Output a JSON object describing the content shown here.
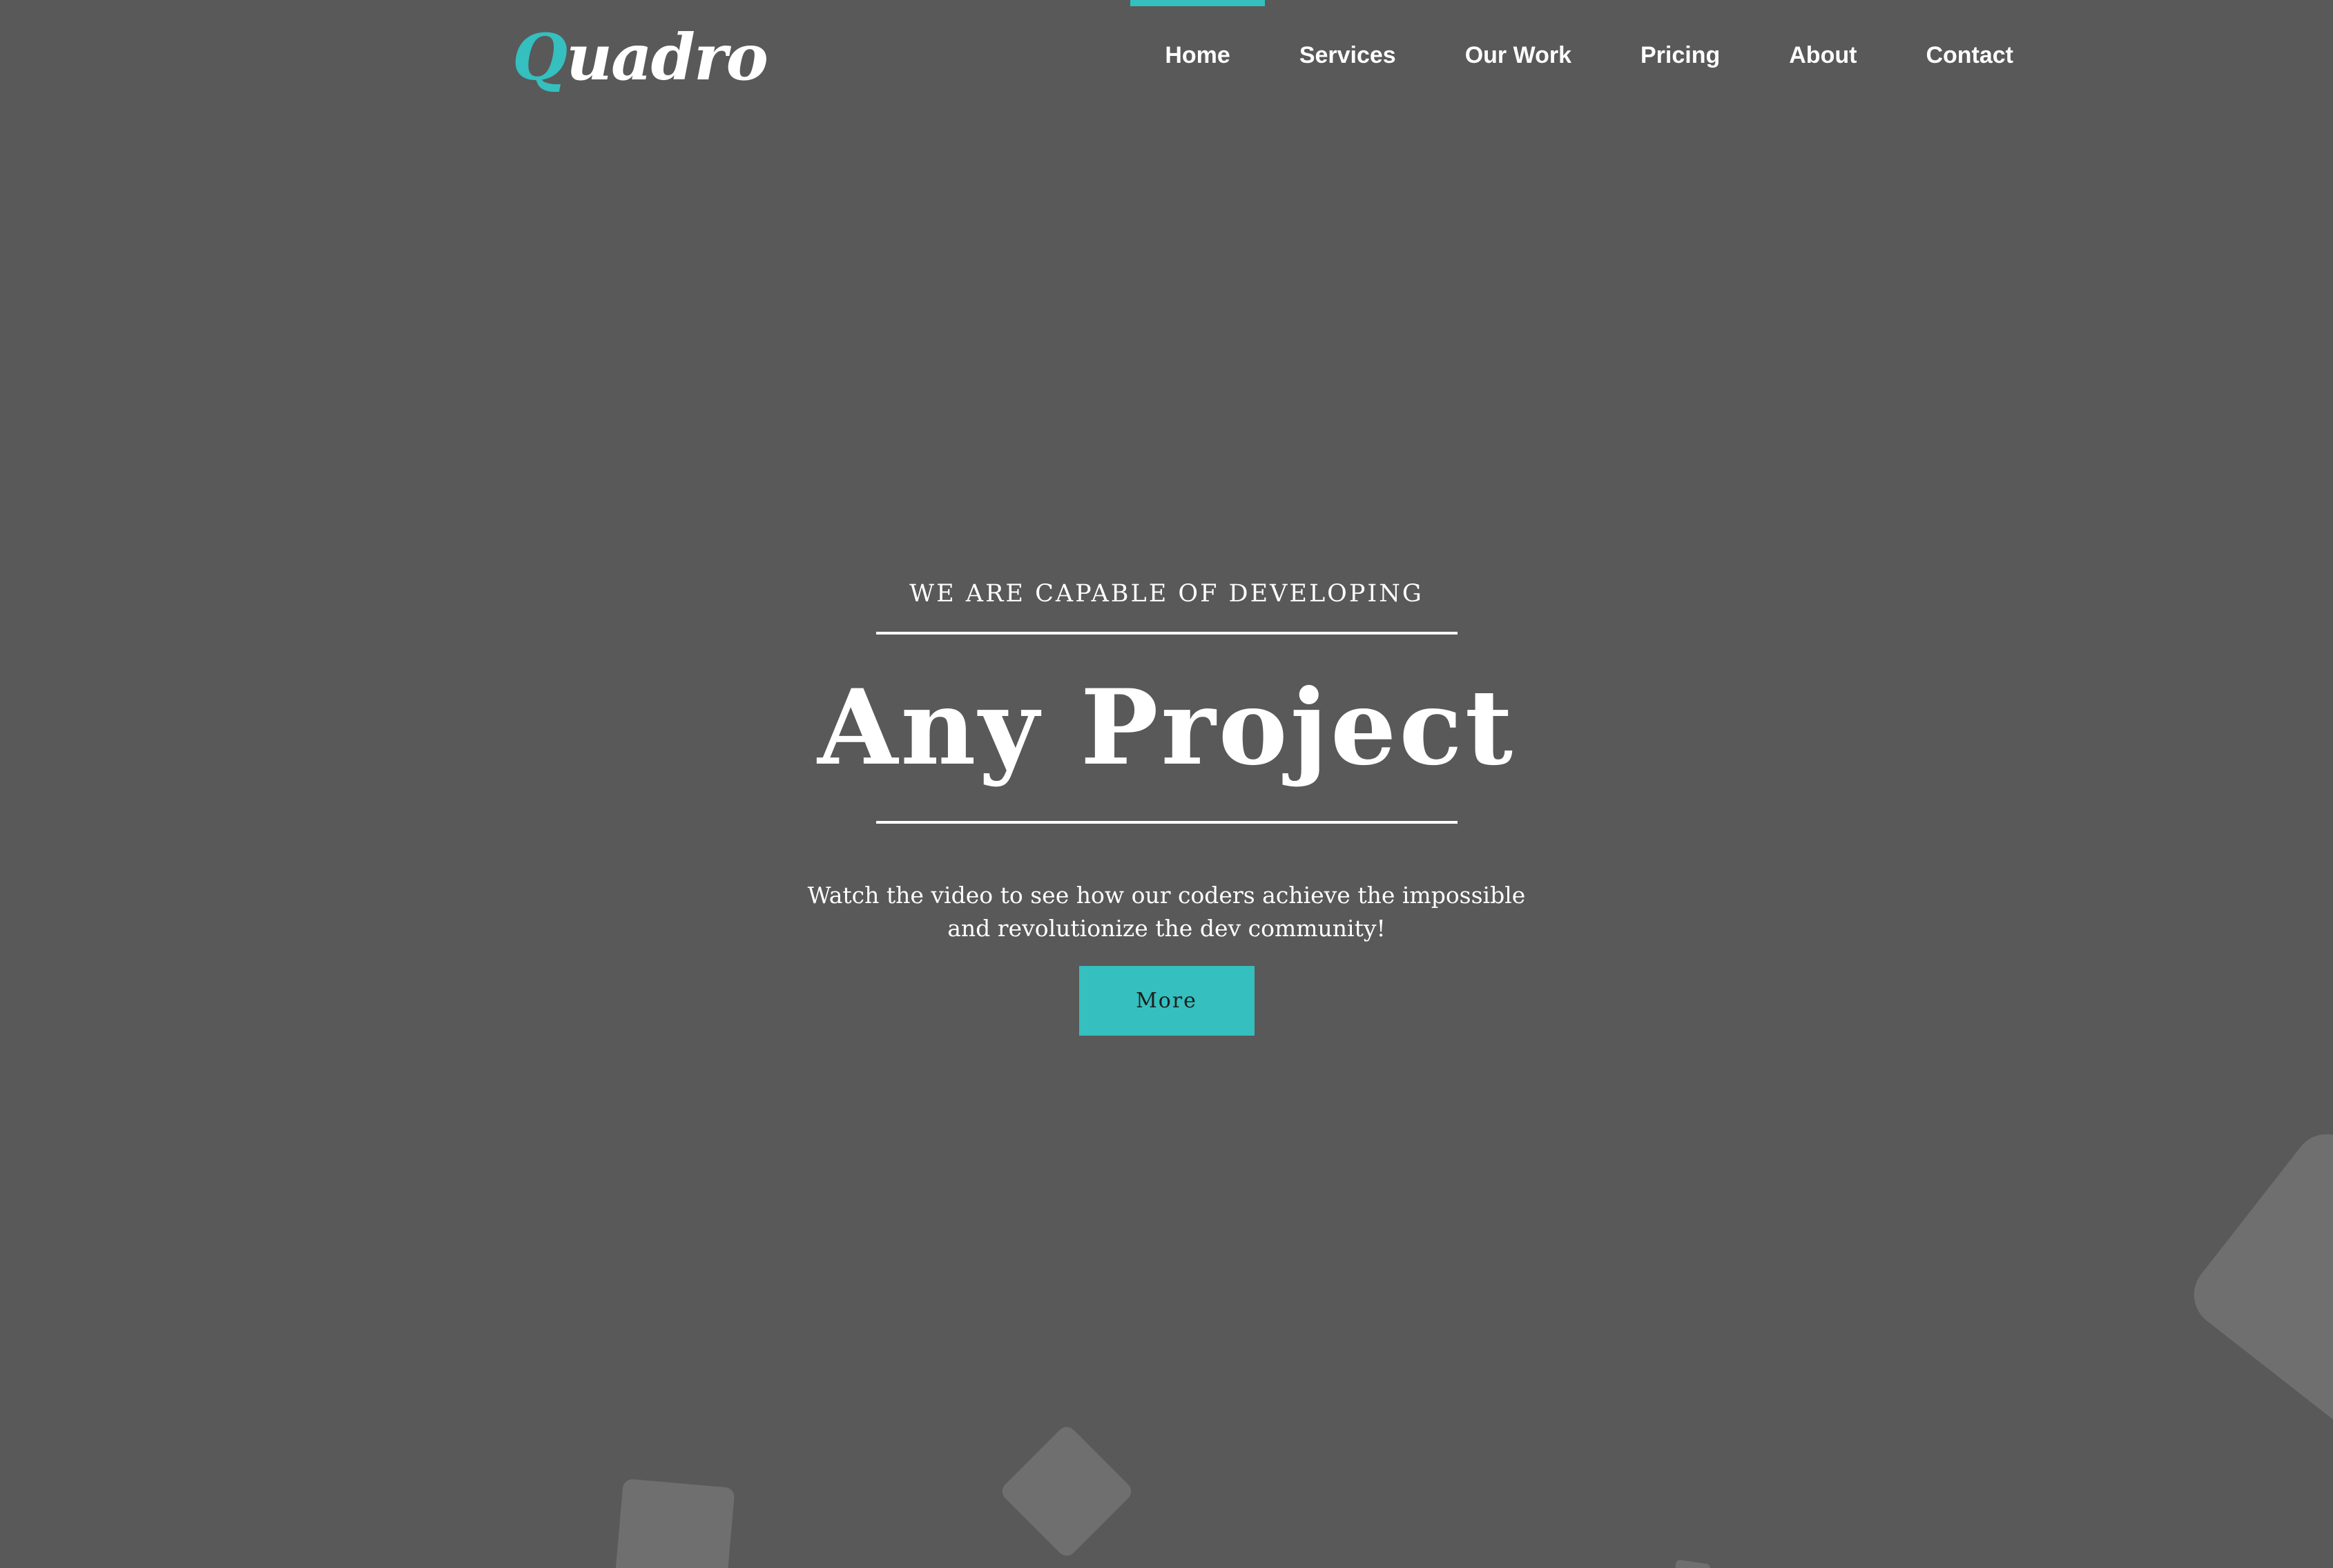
{
  "brand": {
    "logo_initial": "Q",
    "logo_rest": "uadro",
    "accent_color": "#35bfbf"
  },
  "nav": {
    "items": [
      {
        "label": "Home",
        "active": true
      },
      {
        "label": "Services"
      },
      {
        "label": "Our Work"
      },
      {
        "label": "Pricing"
      },
      {
        "label": "About"
      },
      {
        "label": "Contact"
      }
    ]
  },
  "hero": {
    "eyebrow": "WE ARE CAPABLE OF DEVELOPING",
    "headline": "Any Project",
    "subtitle": "Watch the video to see how our coders achieve the impossible and revolutionize the dev community!",
    "cta_label": "More"
  },
  "colors": {
    "background": "#595959",
    "decorative_shape": "#6f6f6f",
    "text": "#ffffff"
  }
}
